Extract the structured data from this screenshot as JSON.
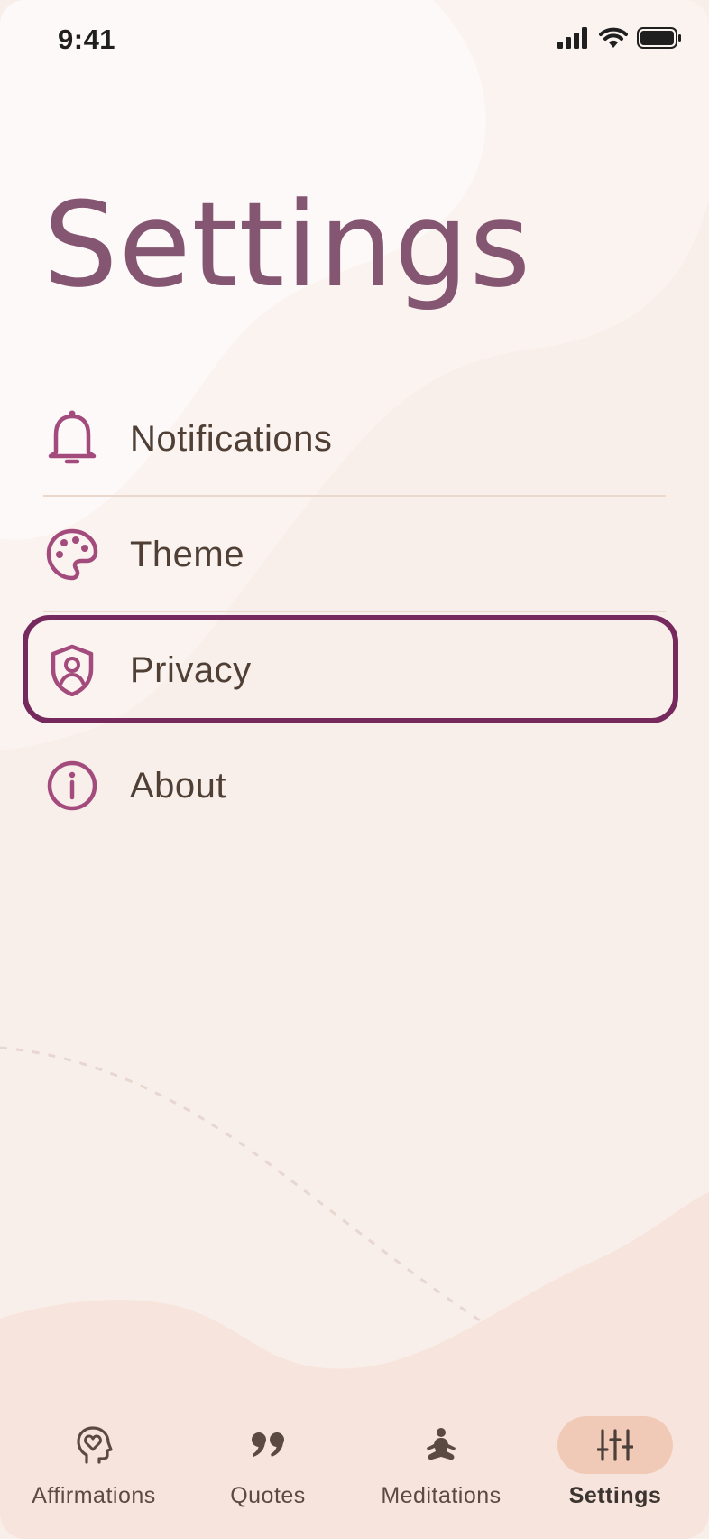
{
  "status_bar": {
    "time": "9:41",
    "icons": [
      "cellular-signal-icon",
      "wifi-icon",
      "battery-icon"
    ]
  },
  "page": {
    "title": "Settings"
  },
  "menu": {
    "items": [
      {
        "label": "Notifications",
        "icon": "bell-icon"
      },
      {
        "label": "Theme",
        "icon": "palette-icon"
      },
      {
        "label": "Privacy",
        "icon": "shield-person-icon",
        "focused": true
      },
      {
        "label": "About",
        "icon": "info-icon"
      }
    ]
  },
  "bottom_nav": {
    "items": [
      {
        "label": "Affirmations",
        "icon": "head-heart-icon"
      },
      {
        "label": "Quotes",
        "icon": "quote-icon"
      },
      {
        "label": "Meditations",
        "icon": "meditation-icon"
      },
      {
        "label": "Settings",
        "icon": "sliders-icon",
        "active": true
      }
    ]
  },
  "colors": {
    "background": "#f9efea",
    "accent": "#855672",
    "icon_accent": "#a34b7d",
    "focus_ring": "#75295d",
    "active_nav_pill": "#f1cab7",
    "text": "#4f3f35"
  }
}
